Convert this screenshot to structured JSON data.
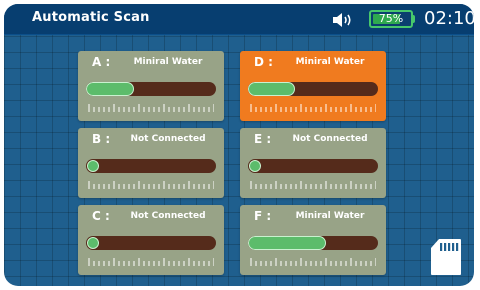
{
  "header": {
    "title": "Automatic Scan",
    "battery": {
      "percent_label": "75%",
      "level": 0.75
    },
    "time": "02:10",
    "icons": {
      "volume": "speaker-icon",
      "battery": "battery-icon"
    }
  },
  "channels": [
    {
      "letter": "A :",
      "status": "Miniral Water",
      "level": 0.37,
      "active": false
    },
    {
      "letter": "B :",
      "status": "Not Connected",
      "level": 0.0,
      "active": false
    },
    {
      "letter": "C :",
      "status": "Not Connected",
      "level": 0.0,
      "active": false
    },
    {
      "letter": "D :",
      "status": "Miniral Water",
      "level": 0.36,
      "active": true
    },
    {
      "letter": "E :",
      "status": "Not Connected",
      "level": 0.0,
      "active": false
    },
    {
      "letter": "F :",
      "status": "Miniral Water",
      "level": 0.6,
      "active": false
    }
  ],
  "storage": {
    "icon": "sd-card-icon"
  },
  "colors": {
    "background": "#1f5f8e",
    "header": "#073e70",
    "panel": "#98a387",
    "panel_active": "#f07b1f",
    "track": "#552b1b",
    "fill": "#5cbc6b",
    "battery": "#47c86b"
  }
}
